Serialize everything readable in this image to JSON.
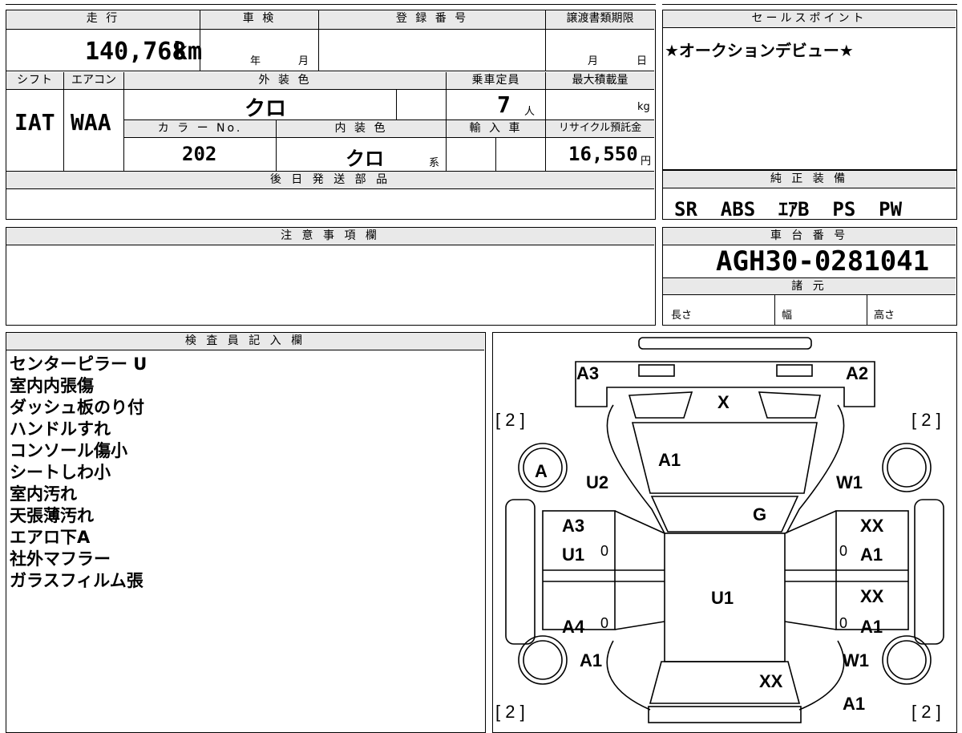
{
  "top_row": {
    "mileage_label": "走 行",
    "mileage_value": "140,768",
    "mileage_unit": "km",
    "inspection_label": "車 検",
    "inspection_year_unit": "年",
    "inspection_month_unit": "月",
    "registration_label": "登 録 番 号",
    "transfer_label": "譲渡書類期限",
    "transfer_month_unit": "月",
    "transfer_day_unit": "日"
  },
  "second_row": {
    "shift_label": "シフト",
    "shift_value": "IAT",
    "ac_label": "エアコン",
    "ac_value": "WAA",
    "exterior_label": "外 装 色",
    "exterior_value": "クロ",
    "capacity_label": "乗車定員",
    "capacity_value": "7",
    "capacity_unit": "人",
    "max_load_label": "最大積載量",
    "max_load_unit": "kg",
    "color_no_label": "カ ラ ー No.",
    "color_no_value": "202",
    "interior_label": "内 装 色",
    "interior_value": "クロ",
    "interior_unit": "系",
    "import_label": "輸 入 車",
    "recycle_label": "リサイクル預託金",
    "recycle_value": "16,550",
    "recycle_unit": "円"
  },
  "later_parts": {
    "label": "後 日 発 送 部 品"
  },
  "sales_point": {
    "label": "セールスポイント",
    "text": "★オークションデビュー★"
  },
  "equipment": {
    "label": "純 正 装 備",
    "value": "SR  ABS  ｴｱB  PS  PW"
  },
  "notes": {
    "label": "注 意 事 項 欄"
  },
  "chassis": {
    "label": "車 台 番 号",
    "value": "AGH30-0281041"
  },
  "specs": {
    "label": "諸 元",
    "length_label": "長さ",
    "width_label": "幅",
    "height_label": "高さ"
  },
  "inspector": {
    "label": "検 査 員 記 入 欄",
    "lines": [
      "センターピラー U",
      "室内内張傷",
      "ダッシュ板のり付",
      "ハンドルすれ",
      "コンソール傷小",
      "シートしわ小",
      "室内汚れ",
      "天張薄汚れ",
      "エアロ下A",
      "社外マフラー",
      "ガラスフィルム張"
    ]
  },
  "diagram": {
    "tire_front_left": "[ 2 ]",
    "tire_front_right": "[ 2 ]",
    "tire_rear_left": "[ 2 ]",
    "tire_rear_right": "[ 2 ]",
    "front_left_corner": "A3",
    "front_right_corner": "A2",
    "windshield_top": "X",
    "hood": "A1",
    "left_wheel_circle": "A",
    "front_left_fender": "U2",
    "front_right_fender": "W1",
    "windshield": "G",
    "left_front_door_1": "A3",
    "left_front_door_2": "U1",
    "right_front_door_1": "XX",
    "right_front_door_2": "A1",
    "roof": "U1",
    "right_rear_door_1": "XX",
    "right_rear_door_2": "A1",
    "left_rear_door": "A4",
    "left_rear_fender": "A1",
    "right_rear_fender": "W1",
    "rear_glass": "XX",
    "rear_right_corner": "A1",
    "zero_mark": "0"
  }
}
